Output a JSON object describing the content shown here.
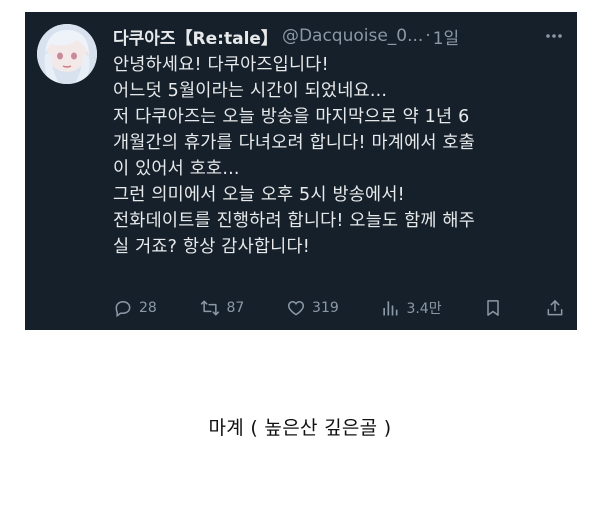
{
  "tweet": {
    "display_name": "다쿠아즈【Re:tale】",
    "handle": "@Dacquoise_0...",
    "separator": "·",
    "time": "1일",
    "lines": [
      "안녕하세요! 다쿠아즈입니다!",
      "어느덧 5월이라는 시간이 되었네요...",
      "저 다쿠아즈는 오늘 방송을 마지막으로 약 1년 6",
      "개월간의 휴가를 다녀오려 합니다! 마계에서 호출",
      "이 있어서 호호...",
      "그런 의미에서 오늘 오후 5시 방송에서!",
      "전화데이트를 진행하려 합니다! 오늘도 함께 해주",
      "실 거죠? 항상 감사합니다!"
    ],
    "actions": {
      "replies": "28",
      "retweets": "87",
      "likes": "319",
      "views": "3.4만"
    }
  },
  "caption": "마계 ( 높은산 깊은골 )",
  "colors": {
    "tweet_bg": "#15202b",
    "text": "#e7e9ea",
    "muted": "#8b98a5"
  },
  "icons": [
    "more-icon",
    "reply-icon",
    "retweet-icon",
    "like-icon",
    "views-icon",
    "bookmark-icon",
    "share-icon"
  ]
}
